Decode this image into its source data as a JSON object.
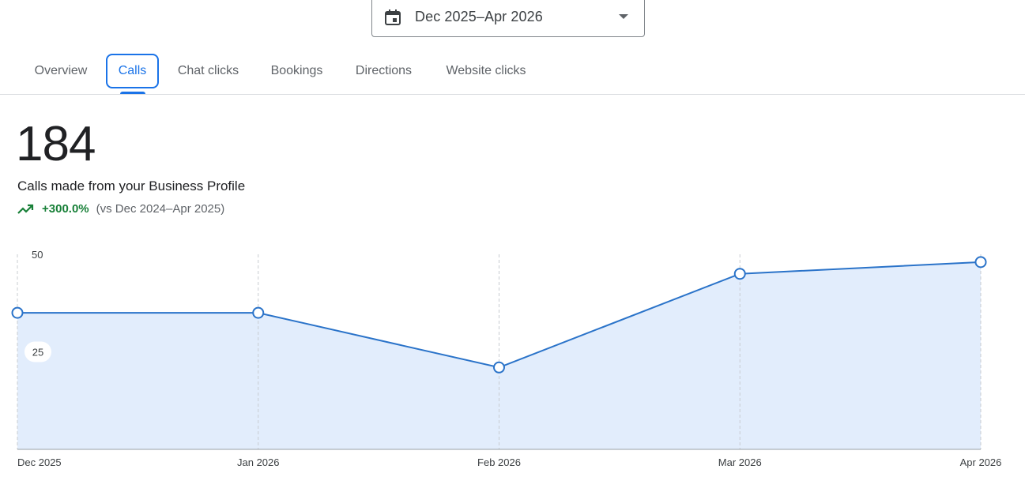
{
  "date_range": {
    "label": "Dec 2025–Apr 2026",
    "icon": "calendar-icon"
  },
  "tabs": [
    {
      "label": "Overview",
      "active": false
    },
    {
      "label": "Calls",
      "active": true
    },
    {
      "label": "Chat clicks",
      "active": false
    },
    {
      "label": "Bookings",
      "active": false
    },
    {
      "label": "Directions",
      "active": false
    },
    {
      "label": "Website clicks",
      "active": false
    }
  ],
  "summary": {
    "value": "184",
    "label": "Calls made from your Business Profile",
    "change": "+300.0%",
    "comparison": "(vs Dec 2024–Apr 2025)",
    "trend_icon": "trending-up-icon"
  },
  "colors": {
    "accent": "#1a73e8",
    "line": "#2a73c9",
    "area": "#e2edfc",
    "positive": "#188038"
  },
  "chart_data": {
    "type": "area",
    "x": [
      "Dec 2025",
      "Jan 2026",
      "Feb 2026",
      "Mar 2026",
      "Apr 2026"
    ],
    "series": [
      {
        "values": [
          35,
          35,
          21,
          45,
          48
        ]
      }
    ],
    "yticks": [
      25,
      50
    ],
    "ylim": [
      0,
      50
    ],
    "grid": "vertical dashed"
  }
}
